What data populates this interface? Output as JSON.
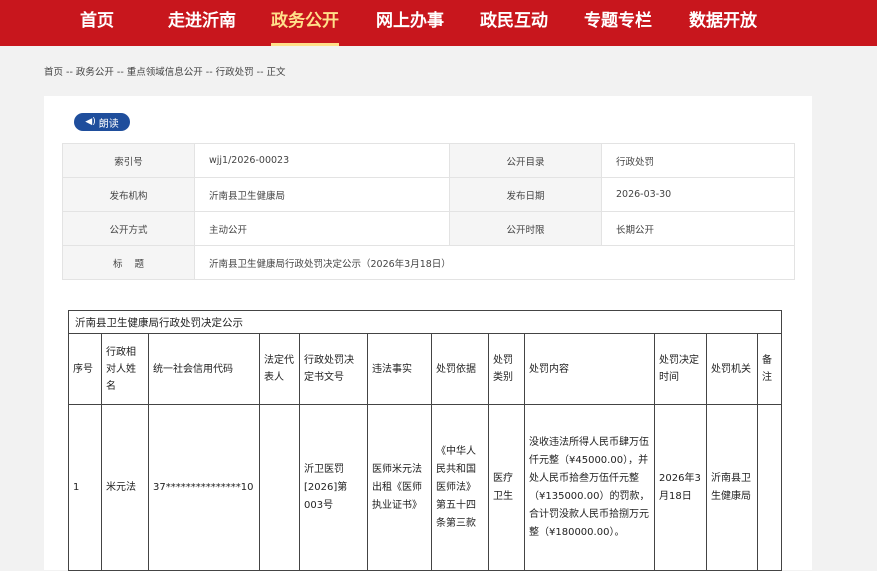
{
  "nav": {
    "items": [
      {
        "label": "首页",
        "active": false
      },
      {
        "label": "走进沂南",
        "active": false
      },
      {
        "label": "政务公开",
        "active": true
      },
      {
        "label": "网上办事",
        "active": false
      },
      {
        "label": "政民互动",
        "active": false
      },
      {
        "label": "专题专栏",
        "active": false
      },
      {
        "label": "数据开放",
        "active": false
      }
    ],
    "bg_color": "#c8161d",
    "active_color": "#ffe08a"
  },
  "breadcrumb": {
    "items": [
      "首页",
      "政务公开",
      "重点领域信息公开",
      "行政处罚",
      "正文"
    ],
    "separator": "--"
  },
  "read_button": {
    "label": "朗读",
    "icon": "speaker-icon"
  },
  "meta": {
    "index_label": "索引号",
    "index_value": "wjj1/2026-00023",
    "catalog_label": "公开目录",
    "catalog_value": "行政处罚",
    "org_label": "发布机构",
    "org_value": "沂南县卫生健康局",
    "date_label": "发布日期",
    "date_value": "2026-03-30",
    "mode_label": "公开方式",
    "mode_value": "主动公开",
    "period_label": "公开时限",
    "period_value": "长期公开",
    "title_label": "标    题",
    "title_value": "沂南县卫生健康局行政处罚决定公示（2026年3月18日）"
  },
  "notice": {
    "caption": "沂南县卫生健康局行政处罚决定公示",
    "headers": [
      "序号",
      "行政相对人姓名",
      "统一社会信用代码",
      "法定代表人",
      "行政处罚决定书文号",
      "违法事实",
      "处罚依据",
      "处罚类别",
      "处罚内容",
      "处罚决定时间",
      "处罚机关",
      "备注"
    ],
    "rows": [
      [
        "1",
        "米元法",
        "37***************10",
        "",
        "沂卫医罚[2026]第003号",
        "医师米元法出租《医师执业证书》",
        "《中华人民共和国医师法》第五十四条第三款",
        "医疗卫生",
        "没收违法所得人民币肆万伍仟元整（¥45000.00），并处人民币拾叁万伍仟元整（¥135000.00）的罚款，合计罚没款人民币拾捌万元整（¥180000.00）。",
        "2026年3月18日",
        "沂南县卫生健康局",
        ""
      ]
    ]
  }
}
